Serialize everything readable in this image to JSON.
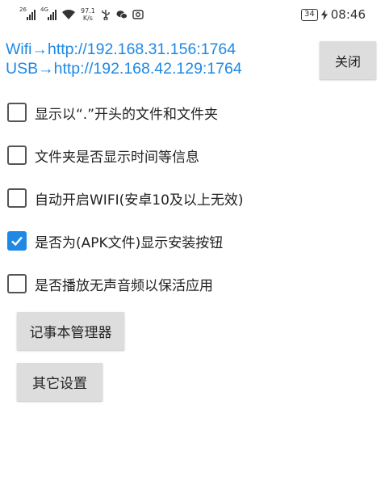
{
  "status_bar": {
    "signal1_tag": "26",
    "signal2_tag": "4G",
    "net_speed_value": "97.1",
    "net_speed_unit": "K/s",
    "battery": "34",
    "time": "08:46"
  },
  "urls": {
    "wifi": "Wifi→http://192.168.31.156:1764",
    "usb": "USB→http://192.168.42.129:1764"
  },
  "close_label": "关闭",
  "options": [
    {
      "label": "显示以“.”开头的文件和文件夹",
      "checked": false
    },
    {
      "label": "文件夹是否显示时间等信息",
      "checked": false
    },
    {
      "label": "自动开启WIFI(安卓10及以上无效)",
      "checked": false
    },
    {
      "label": "是否为(APK文件)显示安装按钮",
      "checked": true
    },
    {
      "label": "是否播放无声音频以保活应用",
      "checked": false
    }
  ],
  "buttons": {
    "notepad": "记事本管理器",
    "other_settings": "其它设置"
  },
  "colors": {
    "accent": "#1e88e5",
    "button_bg": "#dddddd"
  }
}
